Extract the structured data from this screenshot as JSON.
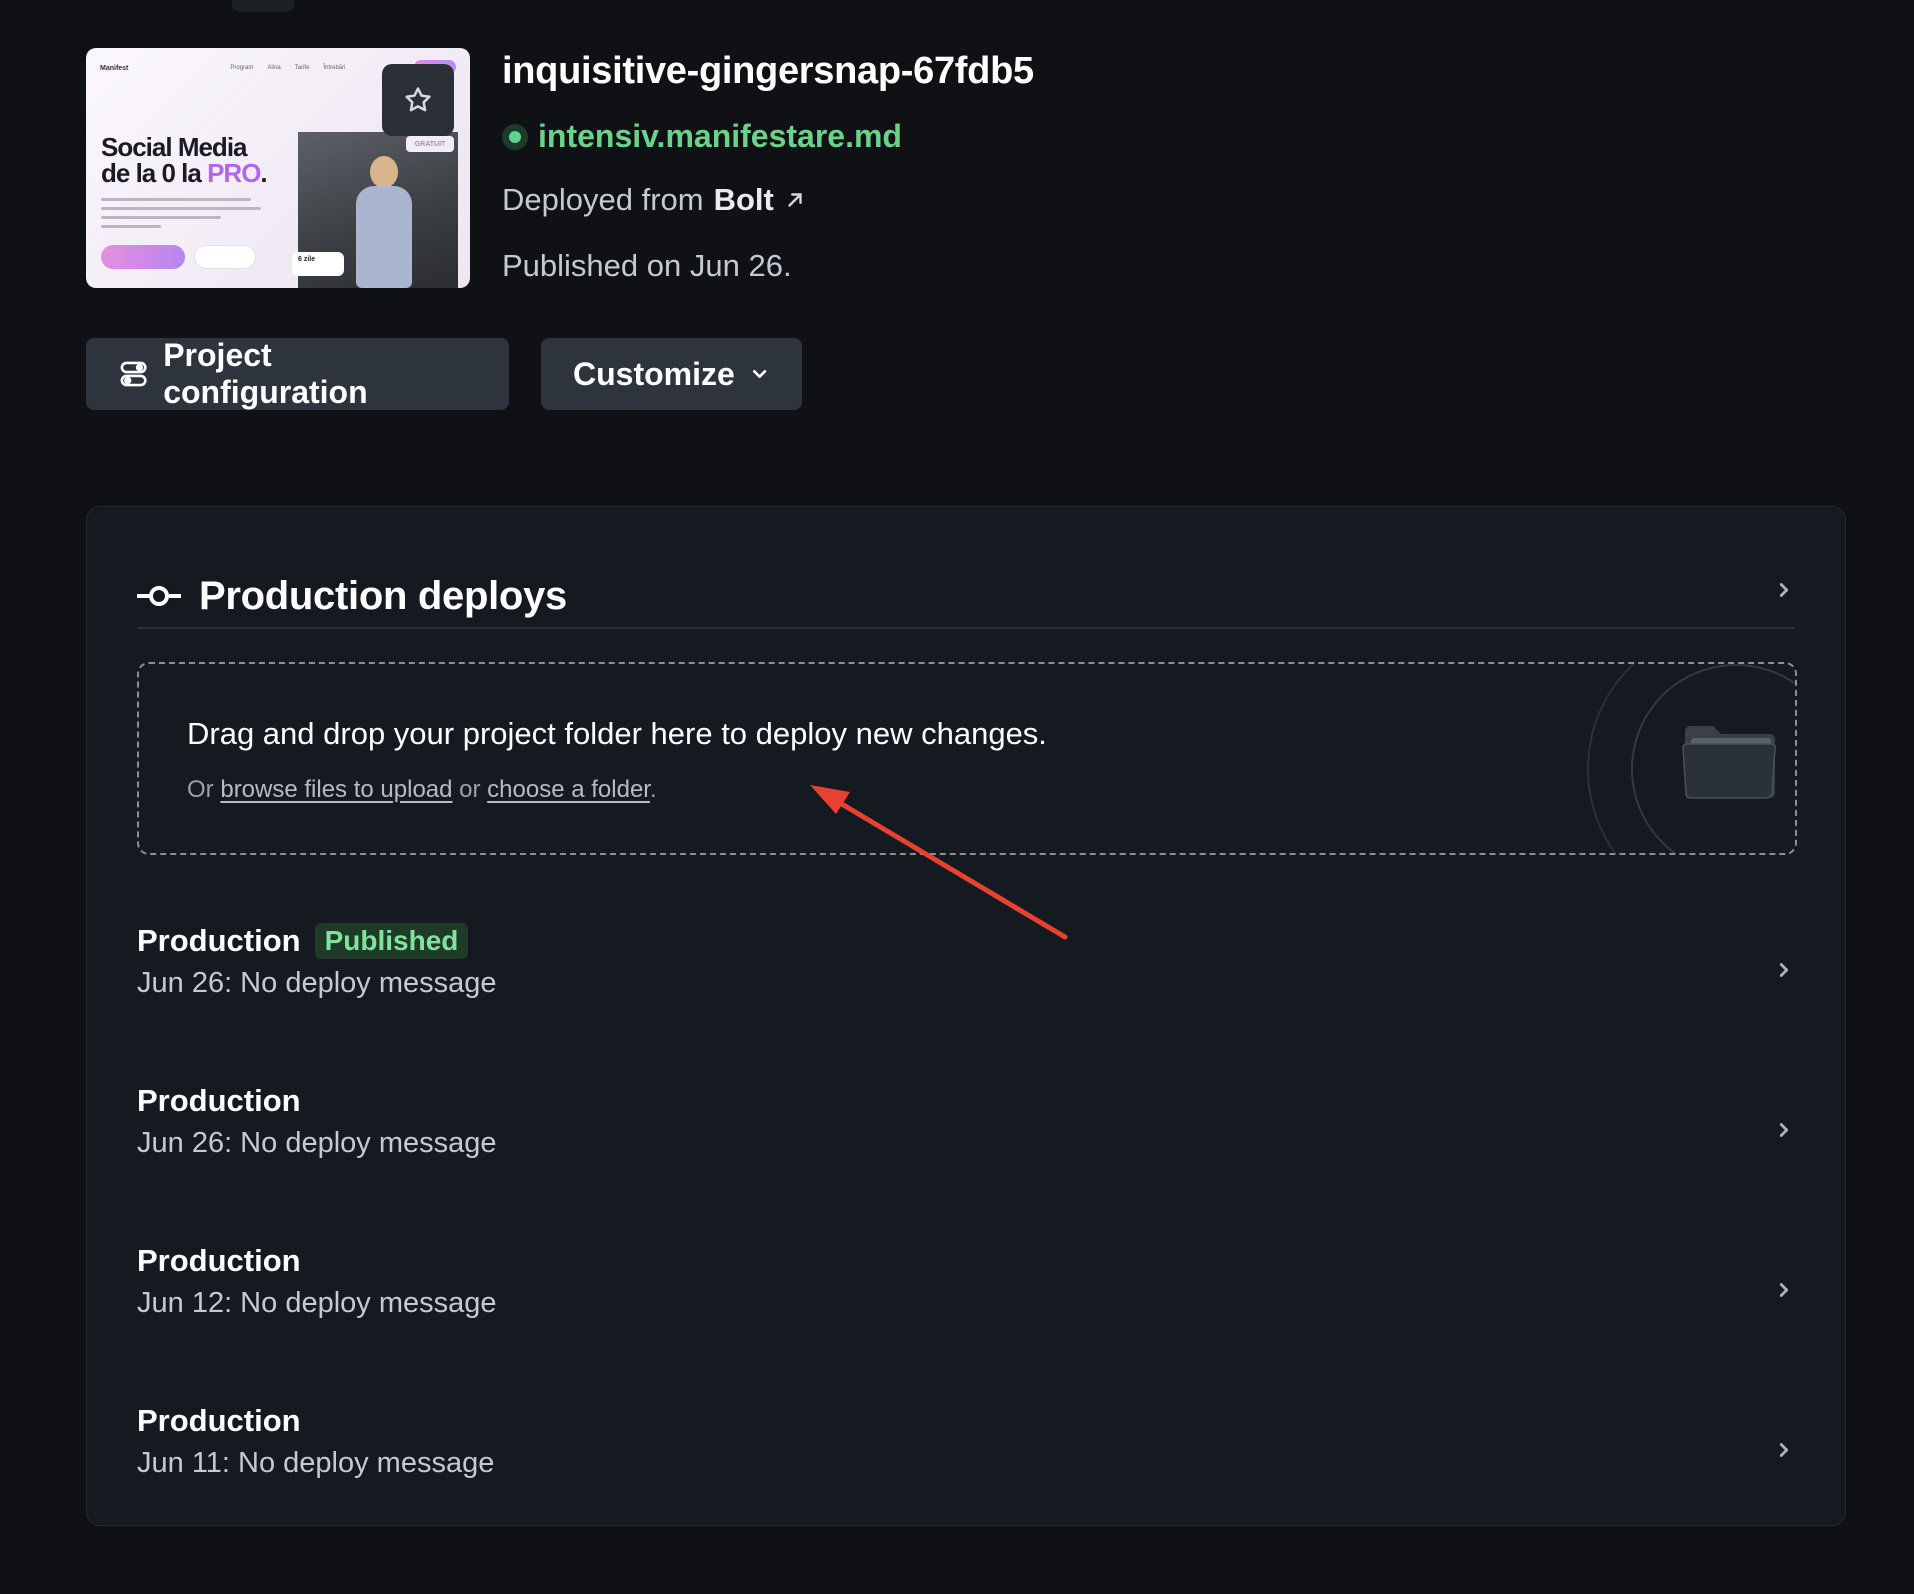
{
  "site": {
    "thumbnail": {
      "brand": "Manifest",
      "nav_links": [
        "Program",
        "Alina",
        "Tarife",
        "Întrebări"
      ],
      "headline_line1": "Social Media",
      "headline_line2_prefix": "de la 0 la",
      "headline_highlight": "PRO",
      "headline_suffix": ".",
      "tag": "GRATUIT",
      "days_label": "6 zile"
    },
    "name": "inquisitive-gingersnap-67fdb5",
    "domain": "intensiv.manifestare.md",
    "deployed_from_prefix": "Deployed from",
    "deployed_from_source": "Bolt",
    "published_on": "Published on Jun 26."
  },
  "actions": {
    "project_configuration": "Project configuration",
    "customize": "Customize"
  },
  "production_deploys": {
    "title": "Production deploys",
    "dropzone": {
      "main_text": "Drag and drop your project folder here to deploy new changes.",
      "sub_prefix": "Or",
      "browse_link": "browse files to upload",
      "sub_middle": "or",
      "folder_link": "choose a folder",
      "sub_suffix": "."
    },
    "deploys": [
      {
        "title": "Production",
        "badge": "Published",
        "message": "Jun 26: No deploy message"
      },
      {
        "title": "Production",
        "badge": "",
        "message": "Jun 26: No deploy message"
      },
      {
        "title": "Production",
        "badge": "",
        "message": "Jun 12: No deploy message"
      },
      {
        "title": "Production",
        "badge": "",
        "message": "Jun 11: No deploy message"
      }
    ]
  },
  "colors": {
    "background": "#0f1115",
    "panel": "#151920",
    "button": "#2e343d",
    "accent_green": "#6ad389",
    "annotation_arrow": "#e8412f"
  },
  "icons": {
    "star": "star-icon",
    "status": "status-dot-icon",
    "external": "external-link-icon",
    "config": "toggles-icon",
    "dropdown": "chevron-down-icon",
    "deploy": "git-commit-icon",
    "row_chevron": "chevron-right-icon",
    "folder": "folder-icon"
  }
}
